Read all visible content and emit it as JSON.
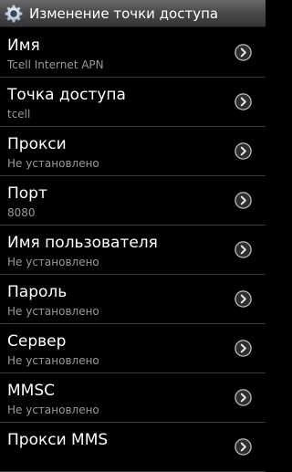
{
  "titlebar": {
    "title": "Изменение точки доступа",
    "icon": "gear-icon"
  },
  "items": [
    {
      "key": "name",
      "label": "Имя",
      "value": "Tcell Internet APN"
    },
    {
      "key": "apn",
      "label": "Точка доступа",
      "value": "tcell"
    },
    {
      "key": "proxy",
      "label": "Прокси",
      "value": "Не установлено"
    },
    {
      "key": "port",
      "label": "Порт",
      "value": "8080"
    },
    {
      "key": "username",
      "label": "Имя пользователя",
      "value": "Не установлено"
    },
    {
      "key": "password",
      "label": "Пароль",
      "value": "Не установлено"
    },
    {
      "key": "server",
      "label": "Сервер",
      "value": "Не установлено"
    },
    {
      "key": "mmsc",
      "label": "MMSC",
      "value": "Не установлено"
    },
    {
      "key": "mms-proxy",
      "label": "Прокси MMS",
      "value": ""
    }
  ],
  "colors": {
    "background": "#000000",
    "divider": "#3b3b3b",
    "secondary_text": "#9a9a9a"
  }
}
